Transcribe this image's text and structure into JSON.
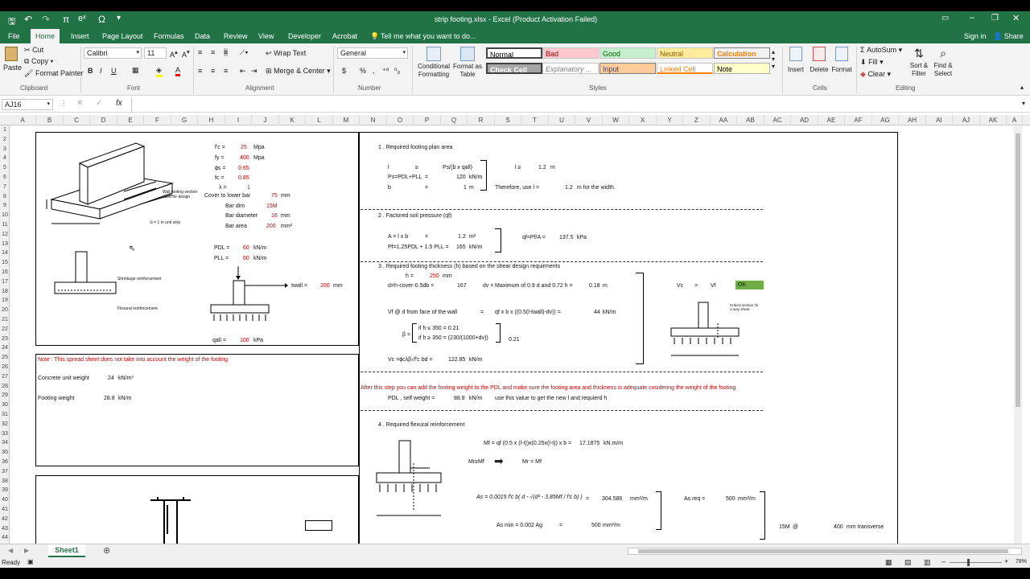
{
  "window": {
    "title": "strip footing.xlsx - Excel (Product Activation Failed)",
    "signin": "Sign in",
    "share": "Share"
  },
  "menu": [
    "File",
    "Home",
    "Insert",
    "Page Layout",
    "Formulas",
    "Data",
    "Review",
    "View",
    "Developer",
    "Acrobat"
  ],
  "tellme": "Tell me what you want to do...",
  "ribbon": {
    "paste": "Paste",
    "cut": "Cut",
    "copy": "Copy",
    "format_painter": "Format Painter",
    "clipboard": "Clipboard",
    "font_name": "Calibri",
    "font_size": "11",
    "font": "Font",
    "bold": "B",
    "italic": "I",
    "underline": "U",
    "wrap_text": "Wrap Text",
    "merge_center": "Merge & Center",
    "alignment": "Alignment",
    "number_format": "General",
    "number": "Number",
    "currency": "$",
    "percent": "%",
    "comma": ",",
    "cond_format": "Conditional Formatting",
    "format_table": "Format as Table",
    "styles": {
      "normal": "Normal",
      "bad": "Bad",
      "good": "Good",
      "neutral": "Neutral",
      "calculation": "Calculation",
      "check_cell": "Check Cell",
      "explanatory": "Explanatory ...",
      "input": "Input",
      "linked_cell": "Linked Cell",
      "note": "Note"
    },
    "styles_group": "Styles",
    "insert": "Insert",
    "delete": "Delete",
    "format": "Format",
    "cells": "Cells",
    "autosum": "AutoSum",
    "fill": "Fill",
    "clear": "Clear",
    "sort_filter": "Sort & Filter",
    "find_select": "Find & Select",
    "editing": "Editing"
  },
  "namebox": "AJ16",
  "fx": "fx",
  "columns": [
    "A",
    "B",
    "C",
    "D",
    "E",
    "F",
    "G",
    "H",
    "I",
    "J",
    "K",
    "L",
    "M",
    "N",
    "O",
    "P",
    "Q",
    "R",
    "S",
    "T",
    "U",
    "V",
    "W",
    "X",
    "Y",
    "Z",
    "AA",
    "AB",
    "AC",
    "AD",
    "AE",
    "AF",
    "AG",
    "AH",
    "AI",
    "AJ",
    "AK",
    "A"
  ],
  "rows": [
    "1",
    "2",
    "3",
    "4",
    "5",
    "6",
    "7",
    "8",
    "9",
    "10",
    "11",
    "12",
    "13",
    "14",
    "15",
    "16",
    "17",
    "18",
    "19",
    "20",
    "21",
    "22",
    "23",
    "24",
    "25",
    "26",
    "27",
    "28",
    "29",
    "30",
    "31",
    "32",
    "33",
    "34",
    "35",
    "36",
    "37",
    "38",
    "39",
    "40",
    "41",
    "42",
    "43",
    "44"
  ],
  "sheet": {
    "left": {
      "fc_label": "f'c =",
      "fc_val": "25",
      "fc_unit": "Mpa",
      "fy_label": "fy =",
      "fy_val": "400",
      "fy_unit": "Mpa",
      "phis_label": "ϕs =",
      "phis_val": "0.65",
      "phic_label": "fc =",
      "phic_val": "0.85",
      "lambda_label": "λ =",
      "lambda_val": "1",
      "cover_label": "Cover to lower bar",
      "cover_val": "75",
      "cover_unit": "mm",
      "bar1_label": "Bar dim",
      "bar1_val": "15M",
      "bar2_label": "Bar diameter",
      "bar2_val": "16",
      "bar2_unit": "mm",
      "bar3_label": "Bar area",
      "bar3_val": "200",
      "bar3_unit": "mm²",
      "pdl_label": "PDL =",
      "pdl_val": "60",
      "pdl_unit": "kN/m",
      "pll_label": "PLL =",
      "pll_val": "60",
      "pll_unit": "kN/m",
      "twall_label": "twall =",
      "twall_val": "200",
      "twall_unit": "mm",
      "qall_label": "qall =",
      "qall_val": "100",
      "qall_unit": "kPa",
      "img_wall": "Wall footing section used for design",
      "img_strip": "b = 1 m unit strip",
      "img_shrink": "Shrinkage reinforcement",
      "img_flex": "Flexural reinforcement",
      "note": "Note : This spread sheet does not take into account the weight of the footing",
      "conc_label": "Concrete unit weight",
      "conc_val": "24",
      "conc_unit": "kN/m³",
      "fw_label": "Footing weight",
      "fw_val": "28.8",
      "fw_unit": "kN/m"
    },
    "s1": {
      "title": "1 .  Required footing plan area",
      "l": "l",
      "ge": "≥",
      "rhs": "Ps/(b x qall)",
      "lge": "l ≥",
      "lval": "1.2",
      "m": "m",
      "ps_label": "Ps=PDL+PLL",
      "eq": "=",
      "ps_val": "120",
      "ps_unit": "kN/m",
      "b": "b",
      "b_val": "1",
      "b_unit": "m",
      "therefore": "Therefore, use l =",
      "use_val": "1.2",
      "use_unit": "m  for the width."
    },
    "s2": {
      "title": "2 .  Factored soil pressure (qf)",
      "a_label": "A = l x b",
      "a_val": "1.2",
      "a_unit": "m²",
      "pf_label": "Pf=1.25PDL + 1.5 PLL =",
      "pf_val": "165",
      "pf_unit": "kN/m",
      "q_label": "qf=Pf/A =",
      "q_val": "137.5",
      "q_unit": "kPa"
    },
    "s3": {
      "title": "3 .  Required footing thickness (h) based on the shear design requirments",
      "h_label": "h =",
      "h_val": "250",
      "h_unit": "mm",
      "d_label": "d=h-cover-0.5db =",
      "d_val": "167",
      "dv_label": "dv =",
      "dv_text": "Maximum of  0.9 d and 0.72 h =",
      "dv_val": "0.18",
      "dv_unit": "m",
      "vf_label": "Vf @ d from face of the wall",
      "vf_eq": "=",
      "vf_expr": "qf x b x ((0.5(l-twall)-dv)) =",
      "vf_val": "44",
      "vf_unit": "kN/m",
      "beta": "β =",
      "beta1": "if h ≤ 350 = 0.21",
      "beta2": "if h ≥ 350 = (230/(1000+dv))",
      "beta_val": "0.21",
      "vc_label": "Vc =ϕcλβ√f'c bd =",
      "vc_val": "122.85",
      "vc_unit": "kN/m",
      "vc2": "Vc",
      ">": ">",
      "vf2": "Vf",
      "ok": "OK",
      "crit": "Critical section for 1-way shear"
    },
    "weight_note": "After this step you can add the footing weight to the PDL and make sure the footing area and thickness is adequate cosidering the weight of the footing",
    "weight_line": {
      "label": "PDL , self weight =",
      "val": "88.8",
      "unit": "kN/m",
      "text": "use this  value to get the new l and requierd h"
    },
    "s4": {
      "title": "4 .  Required flexural reinforcement",
      "mf_label": "Mf =",
      "mf_expr": "qf (0.5 x (l-t))x(0.25x(l-t)) x b =",
      "mf_val": "17.1875",
      "mf_unit": "kN.m/m",
      "mr_label": "Mr≥Mf",
      "mr_eq": "Mr = Mf",
      "as_expr": "As = 0.0015 f'c b( d - √(d² - 3.85Mf / f'c b) )",
      "as_eq": "=",
      "as_val": "304.586",
      "as_unit": "mm²/m",
      "asreq_label": "As req =",
      "asreq_val": "500",
      "asreq_unit": "mm²/m",
      "asmin_label": "As min = 0.002 Ag",
      "asmin_eq": "=",
      "asmin_val": "500",
      "asmin_unit": "mm²/m",
      "bar": "15M",
      "at": "@",
      "spacing": "400",
      "trans": "mm transverse"
    }
  },
  "sheet_tab": "Sheet1",
  "status": {
    "ready": "Ready",
    "zoom": "78%"
  }
}
